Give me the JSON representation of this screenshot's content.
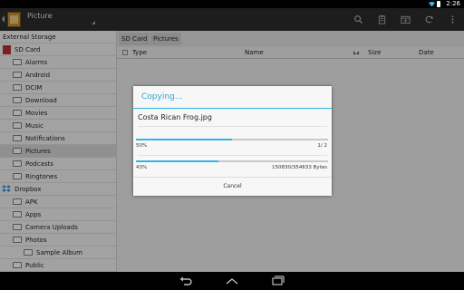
{
  "status_bar": {
    "time": "2:26"
  },
  "action_bar": {
    "title": "Picture"
  },
  "sidebar": {
    "items": [
      {
        "label": "External Storage",
        "indent": 0,
        "icon": "none"
      },
      {
        "label": "SD Card",
        "indent": 0,
        "icon": "sd-card"
      },
      {
        "label": "Alarms",
        "indent": 1,
        "icon": "folder"
      },
      {
        "label": "Android",
        "indent": 1,
        "icon": "folder"
      },
      {
        "label": "DCIM",
        "indent": 1,
        "icon": "folder"
      },
      {
        "label": "Download",
        "indent": 1,
        "icon": "folder"
      },
      {
        "label": "Movies",
        "indent": 1,
        "icon": "folder"
      },
      {
        "label": "Music",
        "indent": 1,
        "icon": "folder"
      },
      {
        "label": "Notifications",
        "indent": 1,
        "icon": "folder"
      },
      {
        "label": "Pictures",
        "indent": 1,
        "icon": "folder",
        "selected": true
      },
      {
        "label": "Podcasts",
        "indent": 1,
        "icon": "folder"
      },
      {
        "label": "Ringtones",
        "indent": 1,
        "icon": "folder"
      },
      {
        "label": "Dropbox",
        "indent": 0,
        "icon": "dropbox"
      },
      {
        "label": "APK",
        "indent": 1,
        "icon": "folder"
      },
      {
        "label": "Apps",
        "indent": 1,
        "icon": "folder"
      },
      {
        "label": "Camera Uploads",
        "indent": 1,
        "icon": "folder"
      },
      {
        "label": "Photos",
        "indent": 1,
        "icon": "folder"
      },
      {
        "label": "Sample Album",
        "indent": 2,
        "icon": "folder"
      },
      {
        "label": "Public",
        "indent": 1,
        "icon": "folder"
      }
    ]
  },
  "breadcrumb": {
    "items": [
      "SD Card",
      "Pictures"
    ]
  },
  "columns": {
    "type": "Type",
    "name": "Name",
    "size": "Size",
    "date": "Date"
  },
  "dialog": {
    "title": "Copying...",
    "file_name": "Costa Rican Frog.jpg",
    "overall": {
      "percent_label": "50%",
      "count": "1/ 2",
      "progress": 0.5
    },
    "file": {
      "percent_label": "43%",
      "bytes": "150830/354633 Bytes",
      "progress": 0.43
    },
    "cancel_label": "Cancel"
  },
  "colors": {
    "accent": "#33b5e5",
    "action_bar": "#2a2a2a",
    "folder_icon": "#c18a2c"
  }
}
